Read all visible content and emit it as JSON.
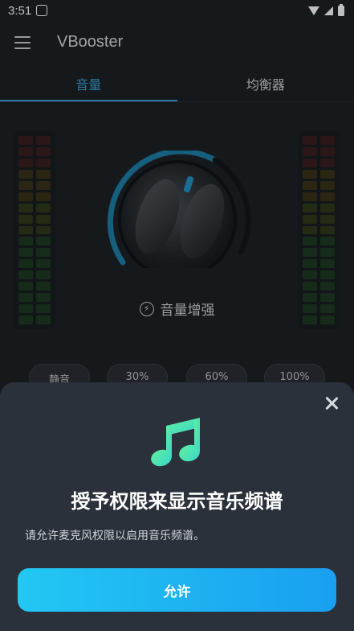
{
  "status_bar": {
    "time": "3:51",
    "icons": [
      "notification-icon",
      "wifi-icon",
      "signal-icon",
      "battery-icon"
    ]
  },
  "app_bar": {
    "title": "VBooster",
    "menu_icon": "menu-icon"
  },
  "tabs": [
    {
      "label": "音量",
      "active": true
    },
    {
      "label": "均衡器",
      "active": false
    }
  ],
  "knob": {
    "label": "音量增强",
    "icon": "bolt-icon",
    "accent_color": "#1e7fa8"
  },
  "presets": [
    "静音",
    "30%",
    "60%",
    "100%"
  ],
  "permission_sheet": {
    "icon": "music-note-icon",
    "title": "授予权限来显示音乐频谱",
    "description": "请允许麦克风权限以启用音乐频谱。",
    "allow_label": "允许",
    "close_icon": "close-icon"
  },
  "colors": {
    "background": "#1d2226",
    "accent": "#3aa3d6",
    "sheet_background": "#2b313a",
    "button_gradient_start": "#22c8f2",
    "button_gradient_end": "#1a9ff0"
  }
}
